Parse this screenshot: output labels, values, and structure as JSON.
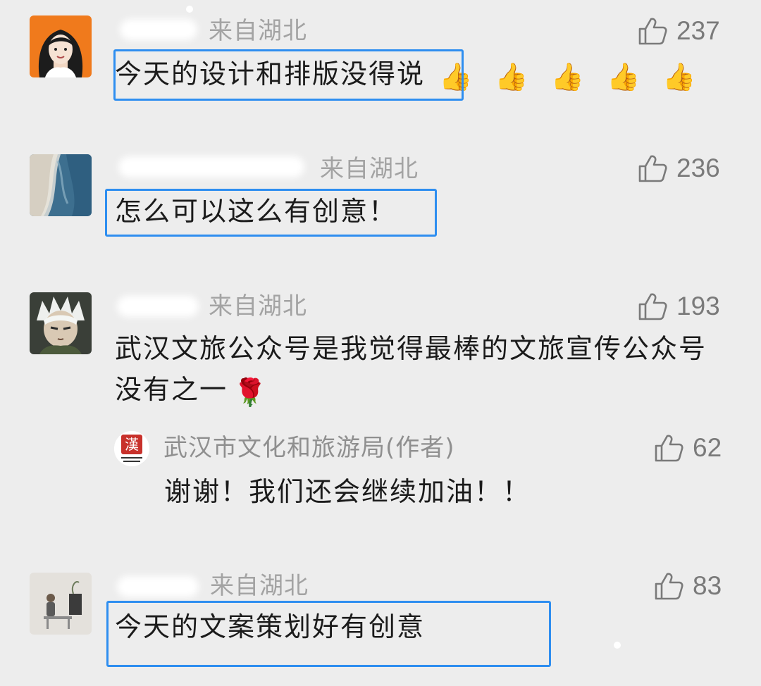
{
  "comments": [
    {
      "location": "来自湖北",
      "likes": "237",
      "text": "今天的设计和排版没得说",
      "reactions": [
        "👍",
        "👍",
        "👍",
        "👍",
        "👍"
      ]
    },
    {
      "location": "来自湖北",
      "likes": "236",
      "text": "怎么可以这么有创意！"
    },
    {
      "location": "来自湖北",
      "likes": "193",
      "text": "武汉文旅公众号是我觉得最棒的文旅宣传公众号没有之一",
      "emoji": "🌹",
      "reply": {
        "author": "武汉市文化和旅游局(作者)",
        "likes": "62",
        "text": "谢谢！我们还会继续加油！！"
      }
    },
    {
      "location": "来自湖北",
      "likes": "83",
      "text": "今天的文案策划好有创意"
    }
  ],
  "icons": {
    "like": "thumbs-up-outline-icon"
  },
  "colors": {
    "background": "#ededed",
    "highlight": "#2e8ef0",
    "secondary_text": "#a3a3a3"
  }
}
